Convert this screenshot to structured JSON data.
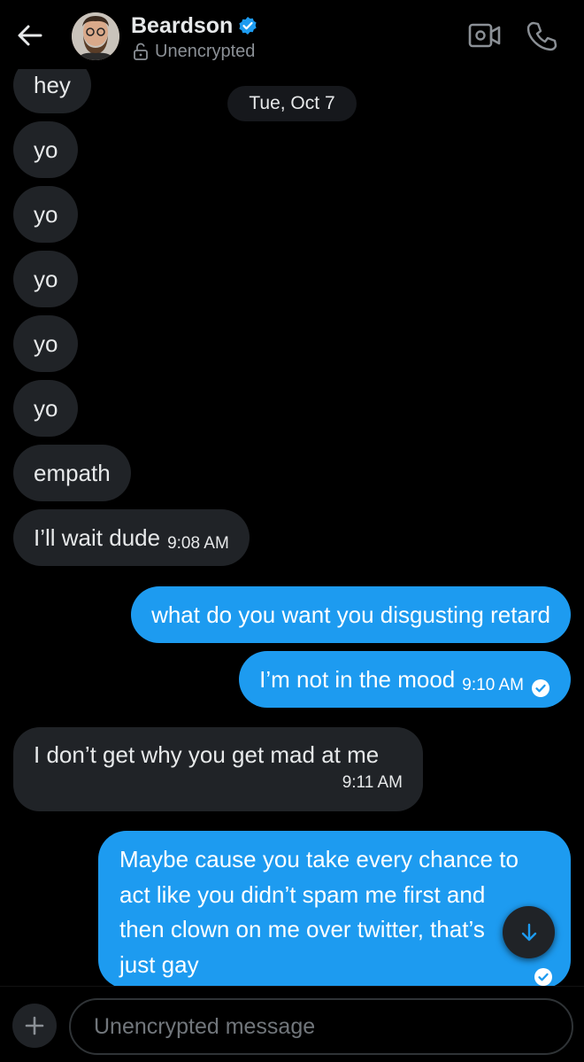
{
  "header": {
    "name": "Beardson",
    "status": "Unencrypted",
    "avatar_icon": "avatar-photo",
    "verified_color": "#1d9bf0"
  },
  "date_divider": "Tue, Oct 7",
  "messages": [
    {
      "dir": "in",
      "text": "hey"
    },
    {
      "dir": "in",
      "text": "yo"
    },
    {
      "dir": "in",
      "text": "yo"
    },
    {
      "dir": "in",
      "text": "yo"
    },
    {
      "dir": "in",
      "text": "yo"
    },
    {
      "dir": "in",
      "text": "yo"
    },
    {
      "dir": "in",
      "text": "empath"
    },
    {
      "dir": "in",
      "text": "I’ll wait dude",
      "time": "9:08 AM"
    },
    {
      "dir": "out",
      "text": "what do you want you disgusting retard"
    },
    {
      "dir": "out",
      "text": "I’m not in the mood",
      "time": "9:10 AM",
      "read": true
    },
    {
      "dir": "in",
      "text": "I don’t get why you get mad at me",
      "time": "9:11 AM"
    },
    {
      "dir": "out",
      "lines": [
        "Maybe cause you take every chance to",
        "act like you didn’t spam me first and",
        "then clown on me over twitter, that’s",
        "just gay"
      ],
      "read": true
    }
  ],
  "composer": {
    "placeholder": "Unencrypted message"
  },
  "colors": {
    "incoming_bubble": "#202327",
    "outgoing_bubble": "#1d9bf0",
    "background": "#000000"
  }
}
